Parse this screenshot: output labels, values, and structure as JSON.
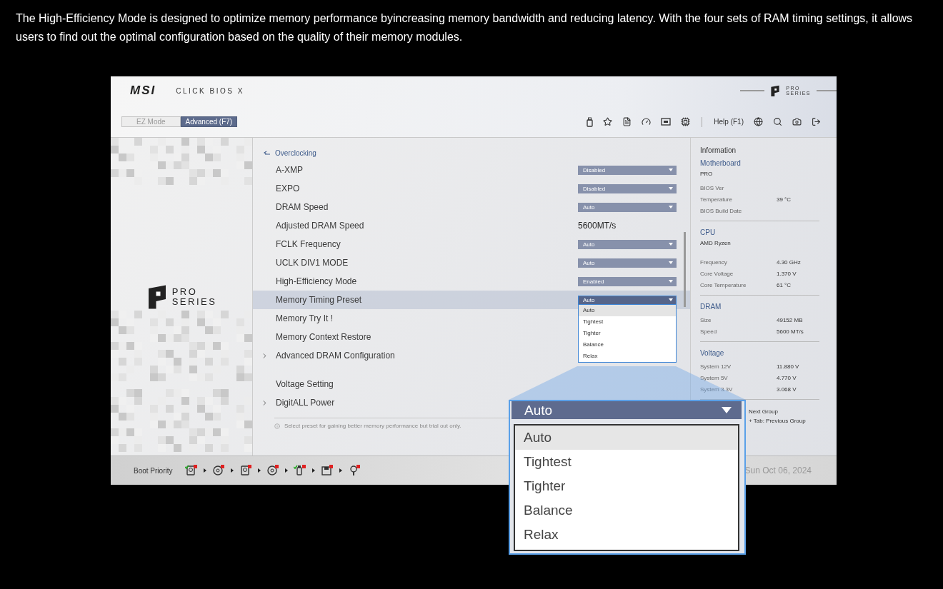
{
  "caption": "The High-Efficiency Mode is designed to optimize memory performance byincreasing memory bandwidth and reducing latency. With the four sets of RAM timing settings, it allows users to find out the optimal configuration based on the quality of their memory modules.",
  "bios": {
    "brand": "MSI",
    "product": "CLICK BIOS X",
    "series_badge": {
      "top": "PRO",
      "bottom": "SERIES"
    },
    "mode_tabs": [
      {
        "label": "EZ Mode",
        "selected": false
      },
      {
        "label": "Advanced (F7)",
        "selected": true
      }
    ],
    "toolbar": {
      "help": "Help (F1)"
    },
    "side_logo": {
      "top": "PRO",
      "bottom": "SERIES"
    },
    "breadcrumb": "Overclocking",
    "settings": [
      {
        "label": "A-XMP",
        "kind": "select",
        "value": "Disabled",
        "selected": false
      },
      {
        "label": "EXPO",
        "kind": "select",
        "value": "Disabled",
        "selected": false
      },
      {
        "label": "DRAM Speed",
        "kind": "select",
        "value": "Auto",
        "selected": false
      },
      {
        "label": "Adjusted DRAM Speed",
        "kind": "readout",
        "value": "5600MT/s",
        "selected": false
      },
      {
        "label": "FCLK Frequency",
        "kind": "select",
        "value": "Auto",
        "selected": false
      },
      {
        "label": "UCLK DIV1 MODE",
        "kind": "select",
        "value": "Auto",
        "selected": false
      },
      {
        "label": "High-Efficiency Mode",
        "kind": "select",
        "value": "Enabled",
        "selected": false
      },
      {
        "label": "Memory Timing Preset",
        "kind": "select",
        "value": "Auto",
        "selected": true,
        "expanded": true
      },
      {
        "label": "Memory Try It !",
        "kind": "action",
        "selected": false
      },
      {
        "label": "Memory Context Restore",
        "kind": "action",
        "selected": false
      },
      {
        "label": "Advanced DRAM Configuration",
        "kind": "submenu",
        "selected": false
      },
      {
        "label": "Voltage Setting",
        "kind": "action",
        "selected": false,
        "gap_before": true
      },
      {
        "label": "DigitALL Power",
        "kind": "submenu",
        "selected": false
      }
    ],
    "dropdown_options": [
      {
        "label": "Auto",
        "selected": true
      },
      {
        "label": "Tightest",
        "selected": false
      },
      {
        "label": "Tighter",
        "selected": false
      },
      {
        "label": "Balance",
        "selected": false
      },
      {
        "label": "Relax",
        "selected": false
      }
    ],
    "hint": "Select preset for gaining better memory performance but trial out only.",
    "info": {
      "title": "Information",
      "groups": [
        {
          "title": "Motherboard",
          "name": "PRO",
          "rows": [
            {
              "label": "BIOS Ver"
            },
            {
              "label": "Temperature",
              "value": "39 °C"
            },
            {
              "label": "BIOS Build Date"
            }
          ]
        },
        {
          "title": "CPU",
          "name": "AMD Ryzen",
          "rows": [
            {
              "label": "Frequency",
              "value": "4.30 GHz"
            },
            {
              "label": "Core Voltage",
              "value": "1.370 V"
            },
            {
              "label": "Core Temperature",
              "value": "61 °C"
            }
          ]
        },
        {
          "title": "DRAM",
          "rows": [
            {
              "label": "Size",
              "value": "49152 MB"
            },
            {
              "label": "Speed",
              "value": "5600 MT/s"
            }
          ]
        },
        {
          "title": "Voltage",
          "rows": [
            {
              "label": "System 12V",
              "value": "11.880 V"
            },
            {
              "label": "System 5V",
              "value": "4.770 V"
            },
            {
              "label": "System 3.3V",
              "value": "3.068 V"
            }
          ]
        }
      ],
      "key_help": [
        "Next Group",
        "+ Tab: Previous Group"
      ]
    },
    "footer": {
      "boot_label": "Boot Priority",
      "boot_devices": [
        {
          "kind": "drive",
          "checked": true
        },
        {
          "kind": "disc",
          "checked": false
        },
        {
          "kind": "drive",
          "checked": false
        },
        {
          "kind": "disc",
          "checked": false
        },
        {
          "kind": "usb",
          "checked": true
        },
        {
          "kind": "floppy",
          "checked": false
        },
        {
          "kind": "network",
          "checked": false
        }
      ],
      "date": "Sun Oct 06, 2024"
    }
  },
  "magnifier": {
    "value": "Auto",
    "options": [
      {
        "label": "Auto",
        "selected": true
      },
      {
        "label": "Tightest",
        "selected": false
      },
      {
        "label": "Tighter",
        "selected": false
      },
      {
        "label": "Balance",
        "selected": false
      },
      {
        "label": "Relax",
        "selected": false
      }
    ]
  }
}
